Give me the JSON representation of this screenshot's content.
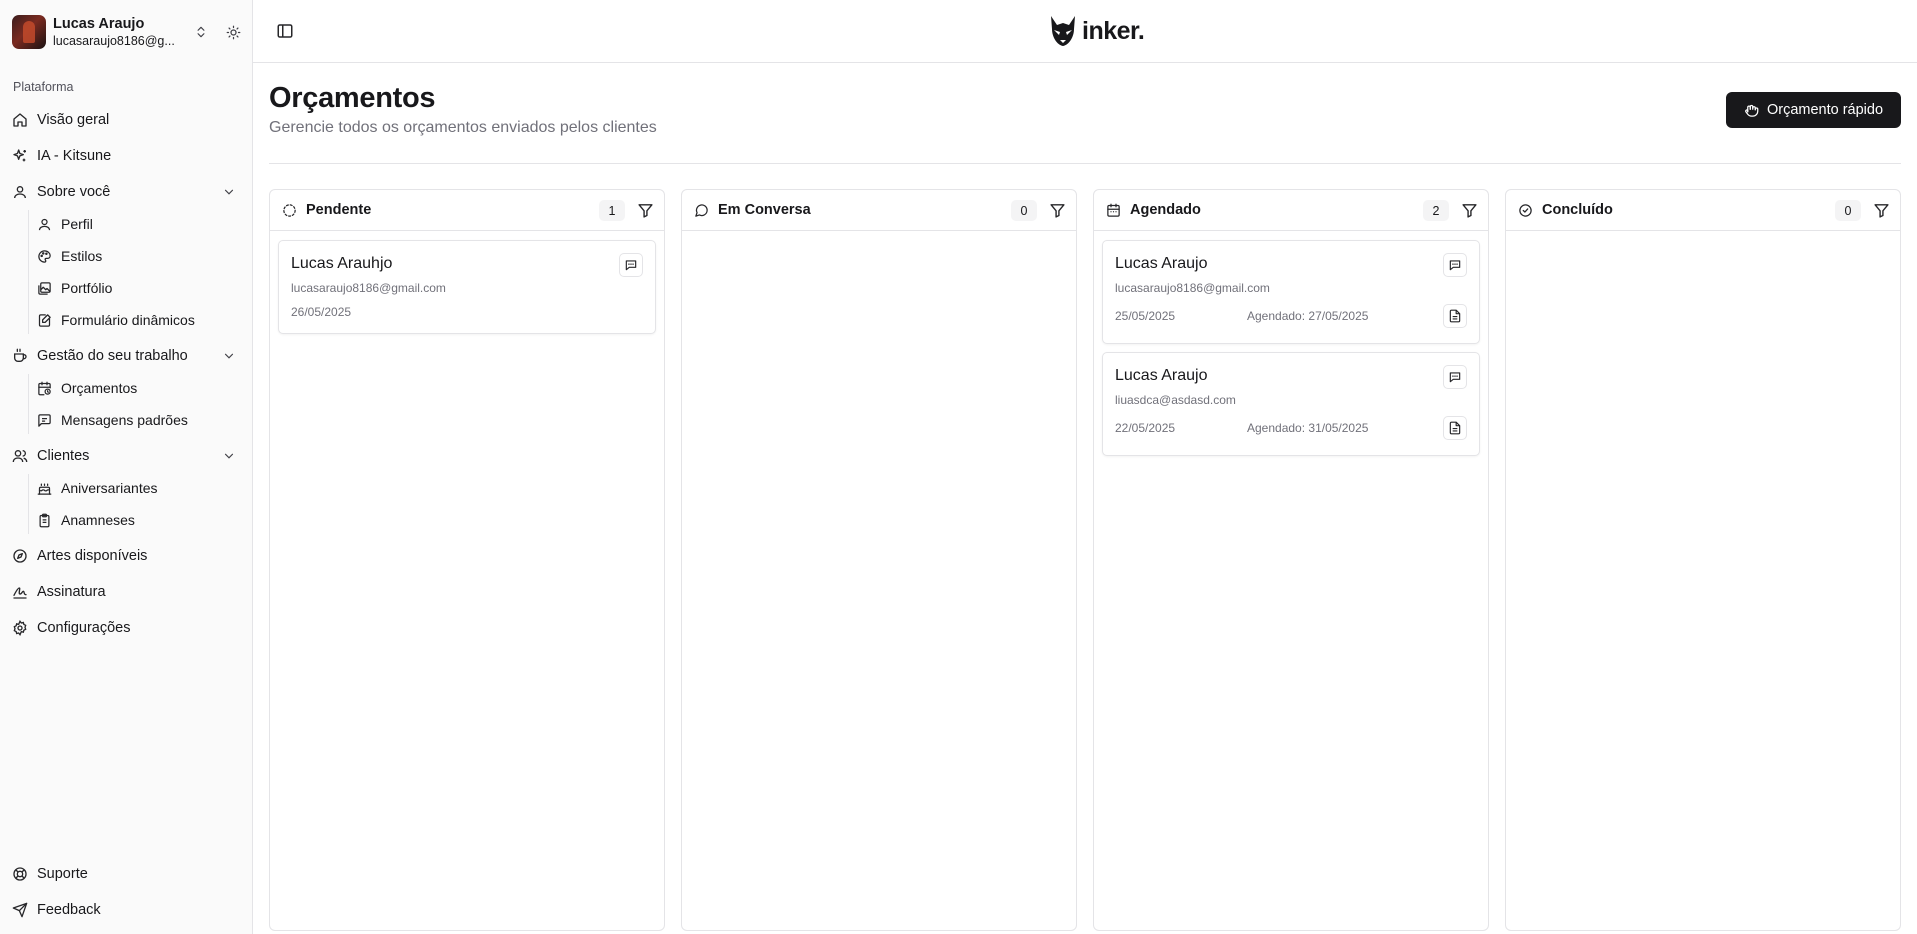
{
  "user": {
    "name": "Lucas Araujo",
    "email": "lucasaraujo8186@g..."
  },
  "sidebar": {
    "section_label": "Plataforma",
    "items": [
      {
        "label": "Visão geral",
        "icon": "home-icon"
      },
      {
        "label": "IA - Kitsune",
        "icon": "sparkles-icon"
      },
      {
        "label": "Sobre você",
        "icon": "user-icon",
        "expanded": true,
        "children": [
          {
            "label": "Perfil",
            "icon": "user-icon"
          },
          {
            "label": "Estilos",
            "icon": "palette-icon"
          },
          {
            "label": "Portfólio",
            "icon": "images-icon"
          },
          {
            "label": "Formulário dinâmicos",
            "icon": "form-icon"
          }
        ]
      },
      {
        "label": "Gestão do seu trabalho",
        "icon": "coffee-icon",
        "expanded": true,
        "children": [
          {
            "label": "Orçamentos",
            "icon": "calendar-clock-icon"
          },
          {
            "label": "Mensagens padrões",
            "icon": "message-square-icon"
          }
        ]
      },
      {
        "label": "Clientes",
        "icon": "users-icon",
        "expanded": true,
        "children": [
          {
            "label": "Aniversariantes",
            "icon": "cake-icon"
          },
          {
            "label": "Anamneses",
            "icon": "clipboard-icon"
          }
        ]
      },
      {
        "label": "Artes disponíveis",
        "icon": "compass-icon"
      },
      {
        "label": "Assinatura",
        "icon": "signature-icon"
      },
      {
        "label": "Configurações",
        "icon": "gear-icon"
      }
    ],
    "footer": [
      {
        "label": "Suporte",
        "icon": "life-buoy-icon"
      },
      {
        "label": "Feedback",
        "icon": "send-icon"
      }
    ]
  },
  "brand": {
    "name": "inker."
  },
  "page": {
    "title": "Orçamentos",
    "subtitle": "Gerencie todos os orçamentos enviados pelos clientes",
    "quick_button": "Orçamento rápido"
  },
  "columns": [
    {
      "title": "Pendente",
      "count": "1",
      "icon": "loader-circle-icon",
      "cards": [
        {
          "name": "Lucas Arauhjo",
          "email": "lucasaraujo8186@gmail.com",
          "date": "26/05/2025",
          "scheduled": ""
        }
      ]
    },
    {
      "title": "Em Conversa",
      "count": "0",
      "icon": "message-circle-icon",
      "cards": []
    },
    {
      "title": "Agendado",
      "count": "2",
      "icon": "calendar-icon",
      "cards": [
        {
          "name": "Lucas Araujo",
          "email": "lucasaraujo8186@gmail.com",
          "date": "25/05/2025",
          "scheduled": "Agendado: 27/05/2025"
        },
        {
          "name": "Lucas Araujo",
          "email": "liuasdca@asdasd.com",
          "date": "22/05/2025",
          "scheduled": "Agendado: 31/05/2025"
        }
      ]
    },
    {
      "title": "Concluído",
      "count": "0",
      "icon": "check-circle-icon",
      "cards": []
    }
  ],
  "colors": {
    "primary": "#18181b",
    "border": "#e4e4e7",
    "muted": "#71717a",
    "sidebar_bg": "#fafafa"
  }
}
